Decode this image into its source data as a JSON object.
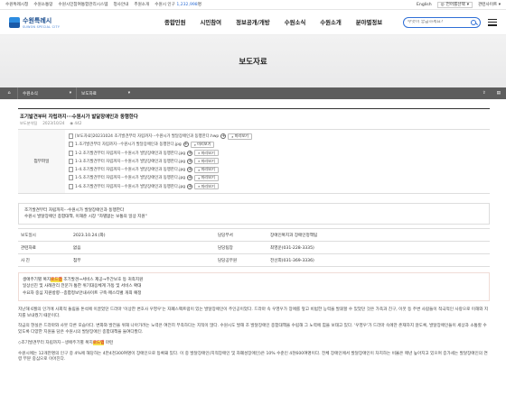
{
  "topbar": {
    "links": [
      "수원특례시청",
      "수원소통망",
      "수원시민참여통합관리시스템",
      "청사안내",
      "추원소개",
      "수원시 인구"
    ],
    "population": "1,232,998",
    "person_unit": "명",
    "lang": "English",
    "language_select": "언어를선택",
    "related_sites": "관련사이트"
  },
  "header": {
    "logo_name": "수원특례시",
    "logo_sub": "SUWON SPECIAL CITY",
    "nav": [
      "종합민원",
      "시민참여",
      "정보공개/개방",
      "수원소식",
      "수원소개",
      "분야별정보"
    ],
    "search_placeholder": "무엇이 궁금하세요?"
  },
  "banner": {
    "title": "보도자료"
  },
  "breadcrumb": {
    "level1": "수원소식",
    "level2": "보도자료"
  },
  "article": {
    "title": "조기발견부터 자립까지···수원시가 발달장애인과 동행한다",
    "dept": "보도분석팀",
    "date": "2023/10/24",
    "views": "442"
  },
  "attachments": {
    "label": "첨부파일",
    "preview_label": "미리보기",
    "files": [
      "[보도자료]20231024 조기발견부터 자립까지···수원시가 발달장애인과 동행한다.hwp",
      "1.조기발견부터 자립까지···수원시가 발달장애인과 동행한다.jpg",
      "1-2.조기발견부터 자립까지···수원시가 발달장애인과 동행한다.jpg",
      "1-3.조기발견부터 자립까지···수원시가 발달장애인과 동행한다.jpg",
      "1-4.조기발견부터 자립까지···수원시가 발달장애인과 동행한다.jpg",
      "1-5.조기발견부터 자립까지···수원시가 발달장애인과 동행한다.jpg",
      "1-6.조기발견부터 자립까지···수원시가 발달장애인과 동행한다.jpg"
    ]
  },
  "intro": {
    "line1": "조기발견부터 자립까지···수원시가 발달장애인과 동행한다",
    "line2": "수원시 발달장애인 종합대책, 이재준 시장 \"차별없는 보통의 일상 지원\""
  },
  "info_table": {
    "rows": [
      [
        "보도일시",
        "2023.10.24.(화)",
        "담당부서",
        "장애인복지과 장애인정책팀"
      ],
      [
        "관련자료",
        "없음",
        "담당팀장",
        "최영운(031-228-3335)"
      ],
      [
        "사 진",
        "첨부",
        "담당공무원",
        "전선희(031-369-3336)"
      ]
    ]
  },
  "summary": {
    "l1_pre": "생애주기별 복지",
    "l1_hl": "로드맵",
    "l1_post": " 조기발견→서비스 제공→주간보호 등 귀족지원",
    "l2": "일상신진 및 사례관리 전문가 통한 위기대응체계 가동 및 서비스 확대",
    "l3": "수요자 중심 지원방향···종합정보안내사이트 구축·매스티벌 개최 예정"
  },
  "body": {
    "p1": "지난해 6월의 인기에 사회적 돌림을 돈석에 이끌었던 드라마 '이상한 변호사 우영우'는 자폐스펙트럼이 있는 발달장애인이 주인공이었다. 드라마 속 우영우가 장애를 앞고 비범한 능력을 발휘할 수 있었던 것은 가족과 친구, 이웃 등 주변 사람들이 적극적인 사랑으로 이해와 지지를 보내줬기 때문이다.",
    "p2": "작금의 현실은 드라마와 사뭇 다른 모습이다. 변화와 발전을 위해 나아가려는 노력은 여전히 부족하다는 지적이 많다. 수원시도 발해 조 발달장애인 종합대책을 수립해 그 노력에 힘을 보태고 있다. '우영우'가 드라마 속에만 존재하지 않도록, 발달장애인들이 세상과 소통할 수 있도록 다양한 지원을 담은 수원시의 발달장애인 종합대책을 들여다봤다.",
    "p3_pre": "◇조기발견부터 자립까지···생애주기별 복지",
    "p3_hl": "로드맵",
    "p3_post": " 마련",
    "p4": "수원시에는 12개만명의 인구 중 4%에 해당하는 4만4천300여명이 장애인으로 등록돼 있다. 이 중 발달장애인(지적장애인 및 자폐성장애인)은 10% 수준인 4천600여명이다. 전체 장애인에서 발달장애인이 차지하는 비율은 매년 높아지고 있으며 증가세는 발달장애인의 연령 부분 중심으로 이어진다."
  }
}
